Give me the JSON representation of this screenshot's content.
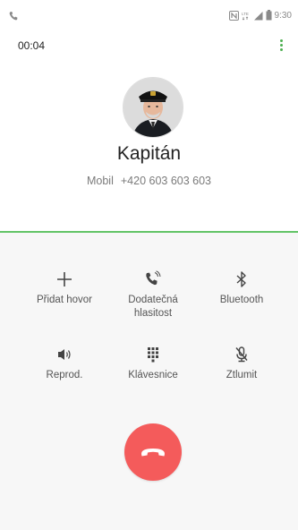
{
  "status_bar": {
    "time": "9:30",
    "icons": [
      "call-icon",
      "nfc-icon",
      "lte-icon",
      "signal-icon",
      "battery-icon"
    ]
  },
  "call": {
    "timer": "00:04",
    "caller_name": "Kapitán",
    "number_type": "Mobil",
    "number": "+420 603 603 603"
  },
  "actions": [
    {
      "label": "Přidat hovor",
      "icon": "plus-icon"
    },
    {
      "label": "Dodatečná\nhlasitost",
      "icon": "extra-volume-icon"
    },
    {
      "label": "Bluetooth",
      "icon": "bluetooth-icon"
    },
    {
      "label": "Reprod.",
      "icon": "speaker-icon"
    },
    {
      "label": "Klávesnice",
      "icon": "keypad-icon"
    },
    {
      "label": "Ztlumit",
      "icon": "mute-icon"
    }
  ],
  "end_call": {
    "icon": "end-call-icon"
  },
  "colors": {
    "accent_green": "#63c467",
    "end_call_red": "#f45b5b",
    "label_gray": "#555555",
    "bottom_bg": "#f7f7f7"
  }
}
